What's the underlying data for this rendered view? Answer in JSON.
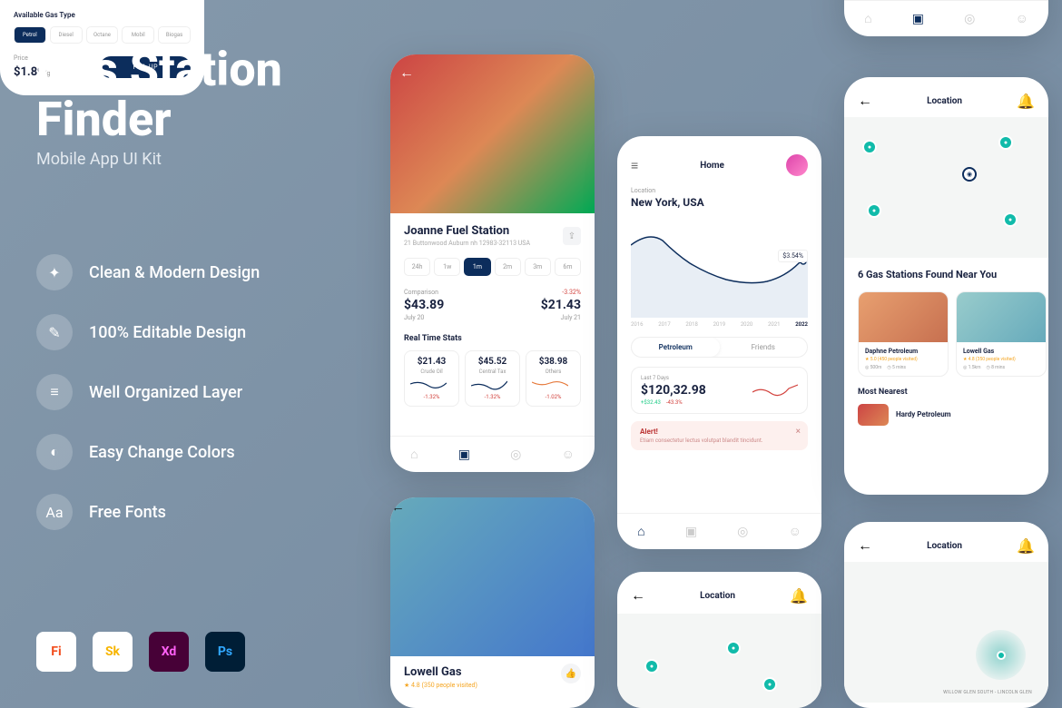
{
  "hero": {
    "title1": "Gas Station",
    "title2": "Finder",
    "subtitle": "Mobile App UI Kit"
  },
  "features": [
    "Clean & Modern Design",
    "100% Editable Design",
    "Well Organized Layer",
    "Easy Change Colors",
    "Free Fonts"
  ],
  "tools": [
    "Fi",
    "Sk",
    "Xd",
    "Ps"
  ],
  "ph1": {
    "station_name": "Joanne Fuel Station",
    "station_addr": "21 Buttonwood Auburn nh 12983-32113 USA",
    "periods": [
      "24h",
      "1w",
      "1m",
      "2m",
      "3m",
      "6m"
    ],
    "active_period": "1m",
    "comparison_label": "Comparison",
    "delta": "-3.32%",
    "left_val": "$43.89",
    "left_date": "July 20",
    "right_val": "$21.43",
    "right_date": "July 21",
    "rts_title": "Real Time Stats",
    "stats": [
      {
        "val": "$21.43",
        "lbl": "Crude Oil",
        "delta": "-1.32%"
      },
      {
        "val": "$45.52",
        "lbl": "Central Tax",
        "delta": "-1.32%"
      },
      {
        "val": "$38.98",
        "lbl": "Others",
        "delta": "-1.02%"
      }
    ]
  },
  "ph2": {
    "name": "Lowell Gas",
    "rating": "★ 4.8 (350 people visited)"
  },
  "ph3": {
    "avail": "Available Gas Type",
    "types": [
      "Petrol",
      "Diesel",
      "Octane",
      "Mobil",
      "Biogas"
    ],
    "active": "Petrol",
    "price_lbl": "Price",
    "price": "$1.89",
    "unit": "/g",
    "fill": "FILL UP"
  },
  "ph4": {
    "title": "Home",
    "loc_lbl": "Location",
    "loc": "New York, USA",
    "badge": "$3.54%",
    "years": [
      "2016",
      "2017",
      "2018",
      "2019",
      "2020",
      "2021",
      "2022"
    ],
    "seg1": "Petroleum",
    "seg2": "Friends",
    "l7_lbl": "Last 7 Days",
    "l7_val": "$120,32.98",
    "l7_up": "+$32.43",
    "l7_down": "-43.3%",
    "alert_title": "Alert!",
    "alert_txt": "Etiam consectetur lectus volutpat blandit tincidunt."
  },
  "ph5_title": "Location",
  "ph6_stats": [
    {
      "delta": "-1.32%"
    },
    {
      "delta": "-1.32%"
    },
    {
      "delta": "-1.02%"
    }
  ],
  "ph7": {
    "title": "Location",
    "found": "6 Gas Stations Found Near You",
    "cards": [
      {
        "name": "Daphne Petroleum",
        "rating": "★ 5.0 (450 people visited)",
        "dist": "◎ 500m",
        "time": "◷ 5 mins"
      },
      {
        "name": "Lowell Gas",
        "rating": "★ 4.8 (350 people visited)",
        "dist": "◎ 1.5km",
        "time": "◷ 8 mins"
      }
    ],
    "nearest_title": "Most Nearest",
    "nearest_name": "Hardy Petroleum"
  },
  "ph8": {
    "title": "Location",
    "label": "WILLOW GLEN SOUTH - LINCOLN GLEN"
  }
}
